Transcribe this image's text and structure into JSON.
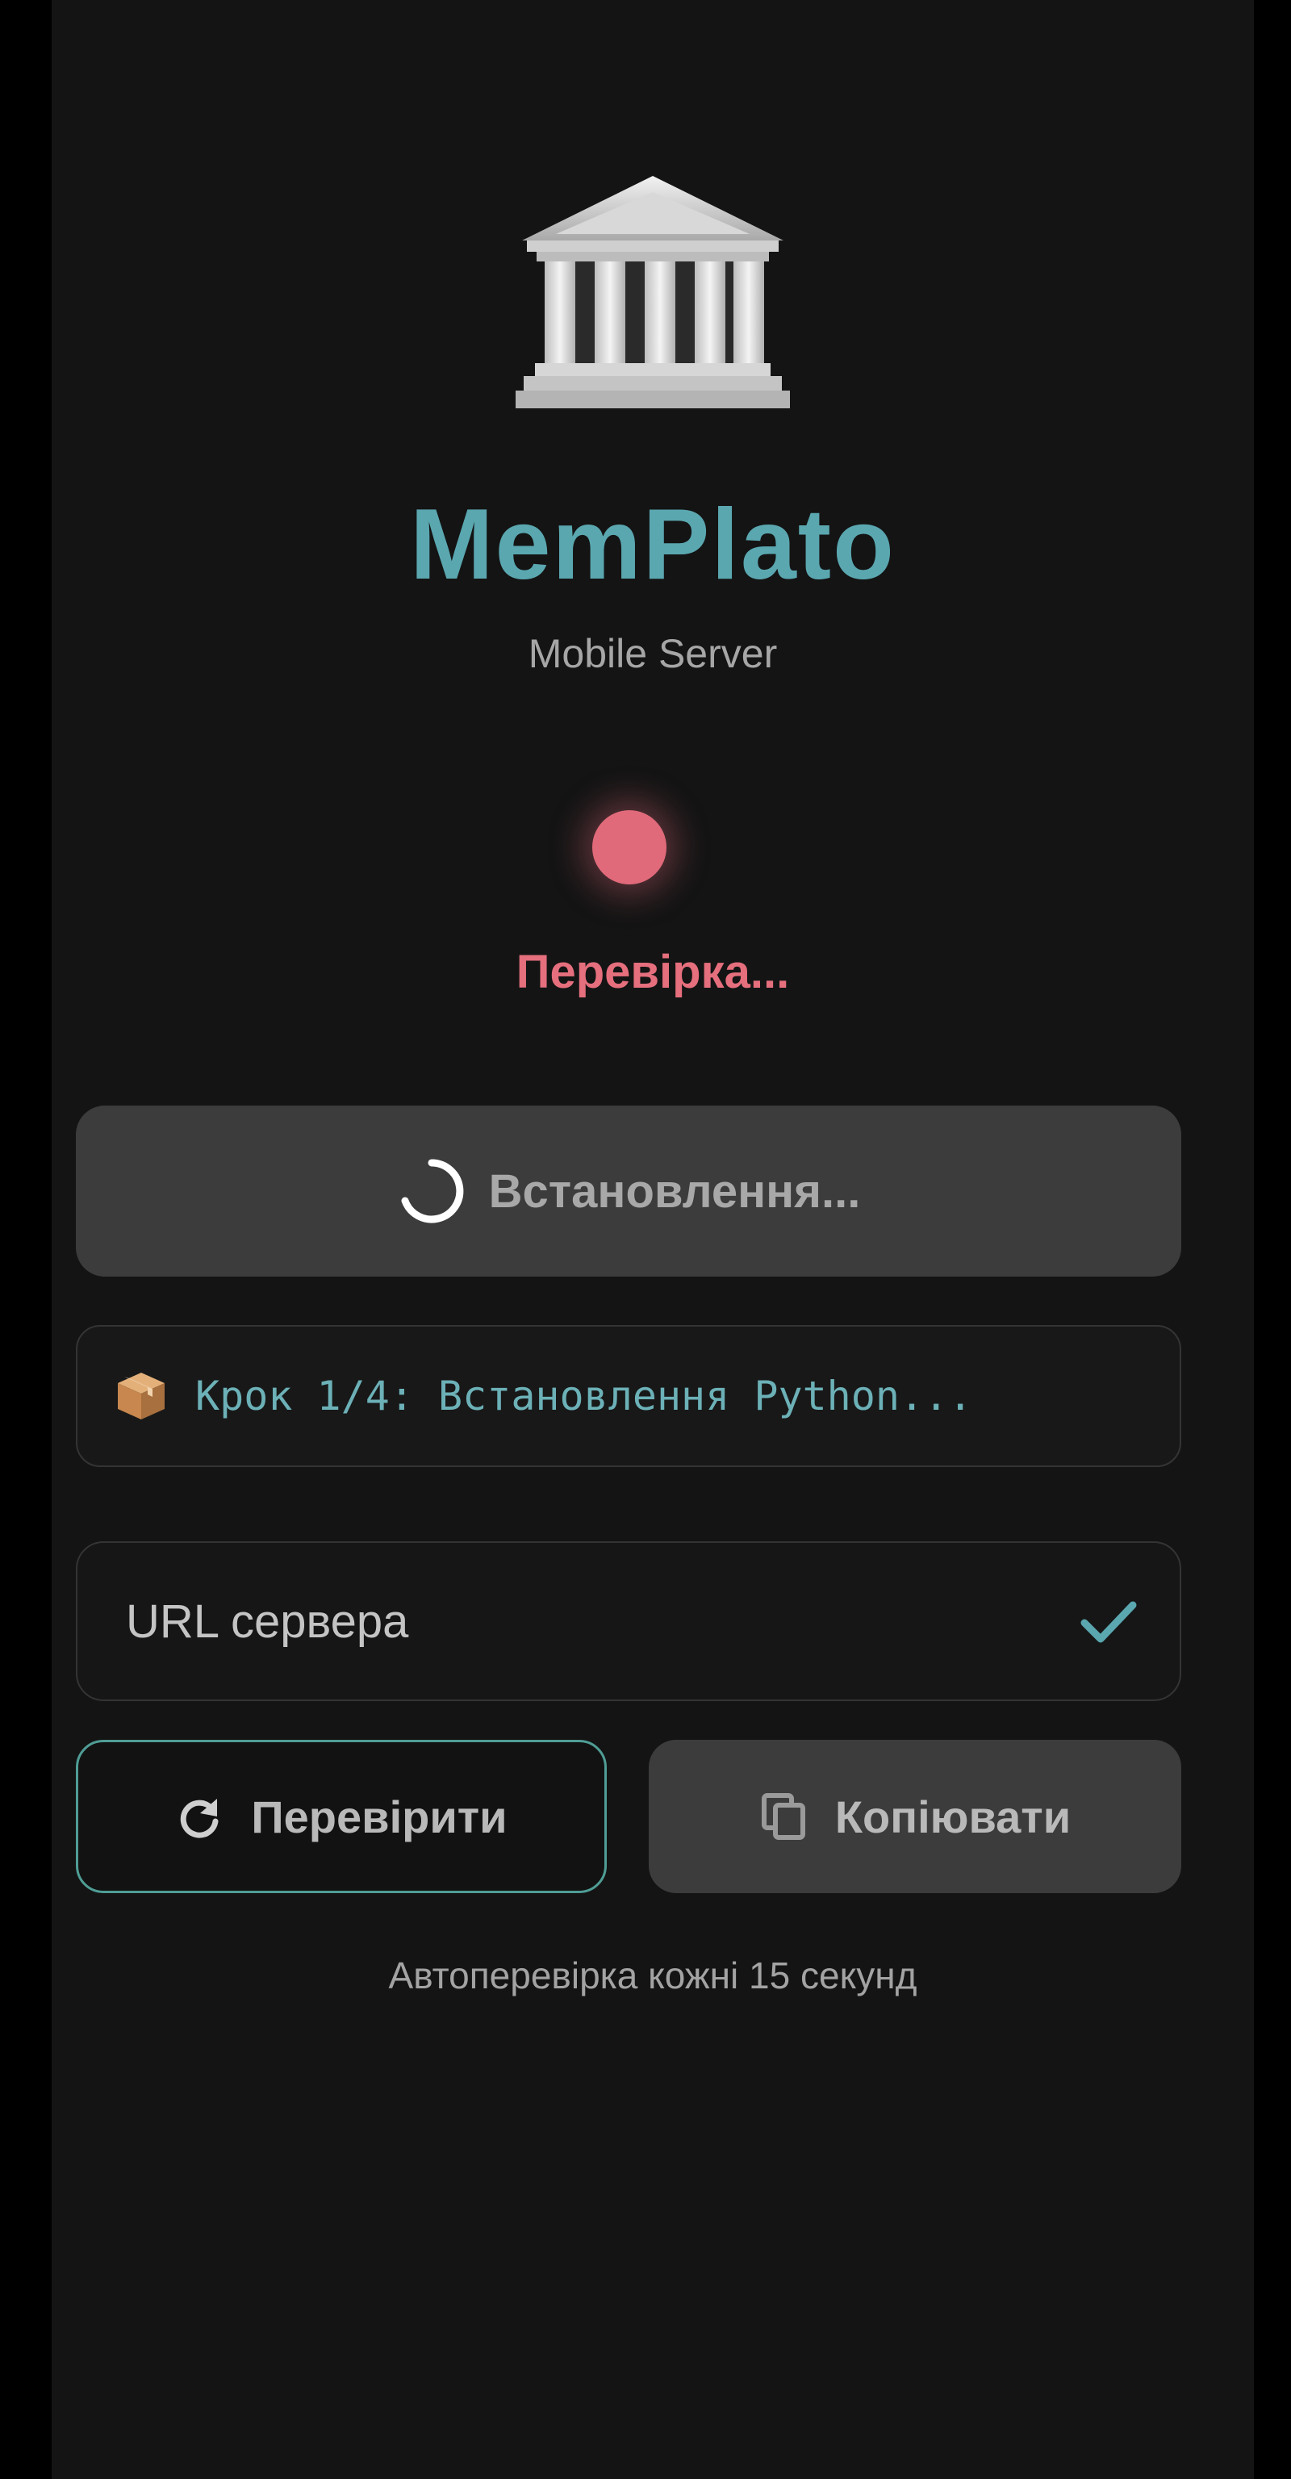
{
  "app": {
    "title": "MemPlato",
    "subtitle": "Mobile Server",
    "logo_icon": "classical-building-icon"
  },
  "status": {
    "text": "Перевірка...",
    "dot_color": "#e06a7a"
  },
  "install_button": {
    "label": "Встановлення...",
    "icon": "spinner-icon"
  },
  "step": {
    "icon": "package-icon",
    "text": "Крок 1/4: Встановлення Python..."
  },
  "url_field": {
    "label": "URL сервера",
    "icon": "check-icon"
  },
  "buttons": {
    "check_label": "Перевірити",
    "check_icon": "refresh-icon",
    "copy_label": "Копіювати",
    "copy_icon": "copy-icon"
  },
  "footer": {
    "auto_check_text": "Автоперевірка кожні 15 секунд"
  },
  "colors": {
    "accent_teal": "#5aa7b0",
    "status_red": "#e56f7d",
    "background": "#141414"
  }
}
